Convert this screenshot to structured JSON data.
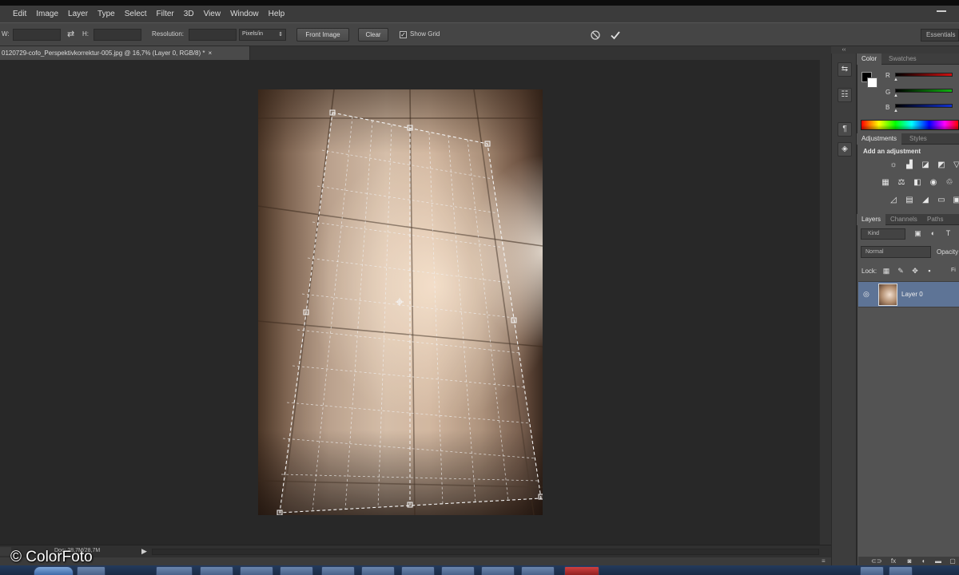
{
  "menu": [
    "Edit",
    "Image",
    "Layer",
    "Type",
    "Select",
    "Filter",
    "3D",
    "View",
    "Window",
    "Help"
  ],
  "options": {
    "w_label": "W:",
    "h_label": "H:",
    "resolution_label": "Resolution:",
    "units": "Pixels/in",
    "front_image": "Front Image",
    "clear": "Clear",
    "show_grid": "Show Grid",
    "show_grid_checked": true,
    "workspace": "Essentials"
  },
  "document": {
    "tab_title": "0120729-cofo_Perspektivkorrektur-005.jpg @ 16,7% (Layer 0, RGB/8) *",
    "close": "×",
    "doc_size": "Doc: 28,7M/28,7M"
  },
  "color_panel": {
    "tabs": [
      "Color",
      "Swatches"
    ],
    "channels": [
      {
        "label": "R",
        "color": "#d01010"
      },
      {
        "label": "G",
        "color": "#10b010"
      },
      {
        "label": "B",
        "color": "#1030d0"
      }
    ]
  },
  "adjustments_panel": {
    "tabs": [
      "Adjustments",
      "Styles"
    ],
    "heading": "Add an adjustment"
  },
  "layers_panel": {
    "tabs": [
      "Layers",
      "Channels",
      "Paths"
    ],
    "filter_kind": "Kind",
    "blend_mode": "Normal",
    "opacity_label": "Opacity",
    "lock_label": "Lock:",
    "fill_label": "Fi",
    "layers": [
      {
        "name": "Layer 0",
        "selected": true
      }
    ]
  },
  "watermark": "© ColorFoto"
}
